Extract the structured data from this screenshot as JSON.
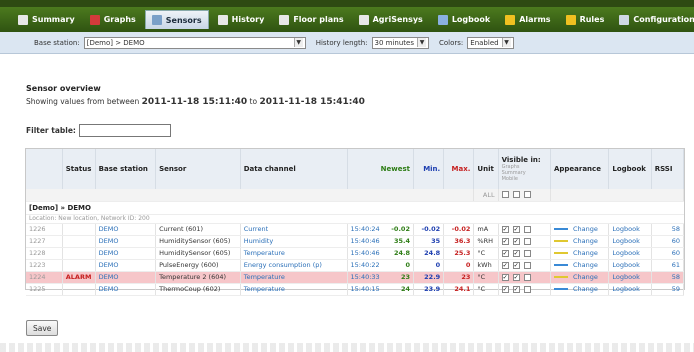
{
  "nav": {
    "tabs": [
      {
        "label": "Summary",
        "icon": "flag-icon",
        "color": "#e7e7e7"
      },
      {
        "label": "Graphs",
        "icon": "chart-icon",
        "color": "#d33b3b"
      },
      {
        "label": "Sensors",
        "icon": "sensor-icon",
        "color": "#7aa0c8"
      },
      {
        "label": "History",
        "icon": "history-icon",
        "color": "#e7e7e7"
      },
      {
        "label": "Floor plans",
        "icon": "floorplan-icon",
        "color": "#e7e7e7"
      },
      {
        "label": "AgriSensys",
        "icon": "agri-icon",
        "color": "#e7e7e7"
      },
      {
        "label": "Logbook",
        "icon": "logbook-icon",
        "color": "#8ab0e0"
      },
      {
        "label": "Alarms",
        "icon": "bell-icon",
        "color": "#f0c020"
      },
      {
        "label": "Rules",
        "icon": "lightning-icon",
        "color": "#f0c020"
      },
      {
        "label": "Configuration",
        "icon": "wrench-icon",
        "color": "#cfd8e4"
      }
    ],
    "active_index": 2
  },
  "subbar": {
    "base_station_label": "Base station:",
    "base_station_value": "[Demo] > DEMO",
    "history_label": "History length:",
    "history_value": "30 minutes",
    "colors_label": "Colors:",
    "colors_value": "Enabled"
  },
  "main": {
    "title": "Sensor overview",
    "showing_prefix": "Showing values from between",
    "from": "2011-11-18 15:11:40",
    "to_word": "to",
    "to": "2011-11-18 15:41:40",
    "filter_label": "Filter table:"
  },
  "table": {
    "headers": {
      "status": "Status",
      "base_station": "Base station",
      "sensor": "Sensor",
      "data_channel": "Data channel",
      "newest": "Newest",
      "min": "Min.",
      "max": "Max.",
      "unit": "Unit",
      "visible_in": "Visible in:",
      "visible_sub1": "Graphs",
      "visible_sub2": "Summary",
      "visible_sub3": "Mobile",
      "appearance": "Appearance",
      "logbook": "Logbook",
      "rssi": "RSSI"
    },
    "all_label": "ALL",
    "group_title": "[Demo] » DEMO",
    "group_sub": "Location: New location, Network ID: 200",
    "rows": [
      {
        "id": "1226",
        "status": "",
        "base": "DEMO",
        "sensor": "Current (601)",
        "channel": "Current",
        "time": "15:40:24",
        "newest": "-0.02",
        "min": "-0.02",
        "max": "-0.02",
        "unit": "mA",
        "swatch": "#3a8ad6",
        "change": "Change",
        "logbook": "Logbook",
        "rssi": "58",
        "alarm": false
      },
      {
        "id": "1227",
        "status": "",
        "base": "DEMO",
        "sensor": "HumiditySensor (605)",
        "channel": "Humidity",
        "time": "15:40:46",
        "newest": "35.4",
        "min": "35",
        "max": "36.3",
        "unit": "%RH",
        "swatch": "#e0c830",
        "change": "Change",
        "logbook": "Logbook",
        "rssi": "60",
        "alarm": false
      },
      {
        "id": "1228",
        "status": "",
        "base": "DEMO",
        "sensor": "HumiditySensor (605)",
        "channel": "Temperature",
        "time": "15:40:46",
        "newest": "24.8",
        "min": "24.8",
        "max": "25.3",
        "unit": "°C",
        "swatch": "#e0c830",
        "change": "Change",
        "logbook": "Logbook",
        "rssi": "60",
        "alarm": false
      },
      {
        "id": "1223",
        "status": "",
        "base": "DEMO",
        "sensor": "PulseEnergy (600)",
        "channel": "Energy consumption (p)",
        "time": "15:40:22",
        "newest": "0",
        "min": "0",
        "max": "0",
        "unit": "kWh",
        "swatch": "#3a8ad6",
        "change": "Change",
        "logbook": "Logbook",
        "rssi": "61",
        "alarm": false
      },
      {
        "id": "1224",
        "status": "ALARM",
        "base": "DEMO",
        "sensor": "Temperature 2 (604)",
        "channel": "Temperature",
        "time": "15:40:33",
        "newest": "23",
        "min": "22.9",
        "max": "23",
        "unit": "°C",
        "swatch": "#e0c830",
        "change": "Change",
        "logbook": "Logbook",
        "rssi": "58",
        "alarm": true
      },
      {
        "id": "1225",
        "status": "",
        "base": "DEMO",
        "sensor": "ThermoCoup (602)",
        "channel": "Temperature",
        "time": "15:40:15",
        "newest": "24",
        "min": "23.9",
        "max": "24.1",
        "unit": "°C",
        "swatch": "#3a8ad6",
        "change": "Change",
        "logbook": "Logbook",
        "rssi": "59",
        "alarm": false
      }
    ]
  },
  "save_label": "Save"
}
